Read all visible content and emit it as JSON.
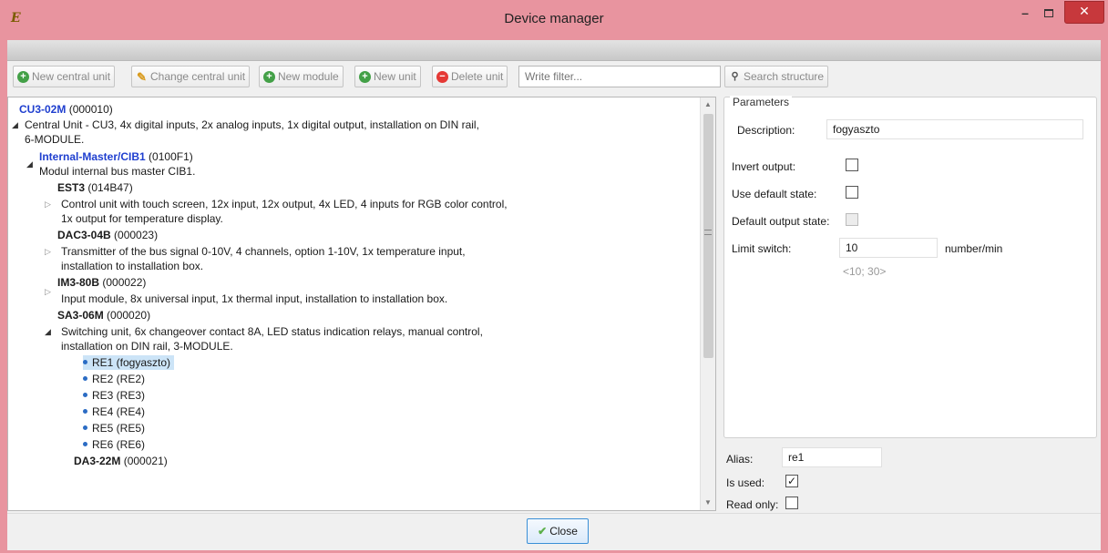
{
  "window": {
    "title": "Device manager",
    "app_icon": "E",
    "min_label": "–",
    "close_label": "✕"
  },
  "toolbar": {
    "new_central_unit": "New central unit",
    "change_central_unit": "Change central unit",
    "new_module": "New module",
    "new_unit": "New unit",
    "delete_unit": "Delete unit",
    "filter_placeholder": "Write filter...",
    "search_structure": "Search structure"
  },
  "tree": {
    "cu_name": "CU3-02M",
    "cu_code": "(000010)",
    "cu_desc1": "Central Unit - CU3, 4x digital inputs, 2x analog inputs, 1x digital output, installation on DIN rail,",
    "cu_desc2": "6-MODULE.",
    "master_name": "Internal-Master/CIB1",
    "master_code": "(0100F1)",
    "master_desc": "Modul internal bus master CIB1.",
    "est_name": "EST3",
    "est_code": "(014B47)",
    "est_desc1": "Control unit with touch screen, 12x input, 12x output, 4x LED, 4 inputs for RGB color control,",
    "est_desc2": "1x output for temperature display.",
    "dac_name": "DAC3-04B",
    "dac_code": "(000023)",
    "dac_desc1": "Transmitter of the bus signal 0-10V, 4 channels, option 1-10V, 1x temperature input,",
    "dac_desc2": "installation to installation box.",
    "im_name": "IM3-80B",
    "im_code": "(000022)",
    "im_desc": "Input module, 8x universal input, 1x thermal input, installation to installation box.",
    "sa_name": "SA3-06M",
    "sa_code": "(000020)",
    "sa_desc1": "Switching unit, 6x changeover contact 8A, LED status indication relays, manual control,",
    "sa_desc2": "installation on DIN rail, 3-MODULE.",
    "relays": [
      "RE1 (fogyaszto)",
      "RE2 (RE2)",
      "RE3 (RE3)",
      "RE4 (RE4)",
      "RE5 (RE5)",
      "RE6 (RE6)"
    ],
    "da_name": "DA3-22M",
    "da_code": "(000021)"
  },
  "params": {
    "legend": "Parameters",
    "description_label": "Description:",
    "description_value": "fogyaszto",
    "invert_output_label": "Invert output:",
    "use_default_state_label": "Use default state:",
    "default_output_state_label": "Default output state:",
    "limit_switch_label": "Limit switch:",
    "limit_switch_value": "10",
    "limit_switch_unit": "number/min",
    "limit_switch_range": "<10; 30>"
  },
  "bottom": {
    "alias_label": "Alias:",
    "alias_value": "re1",
    "is_used_label": "Is used:",
    "is_used_mark": "✓",
    "read_only_label": "Read only:"
  },
  "close_button": "Close"
}
